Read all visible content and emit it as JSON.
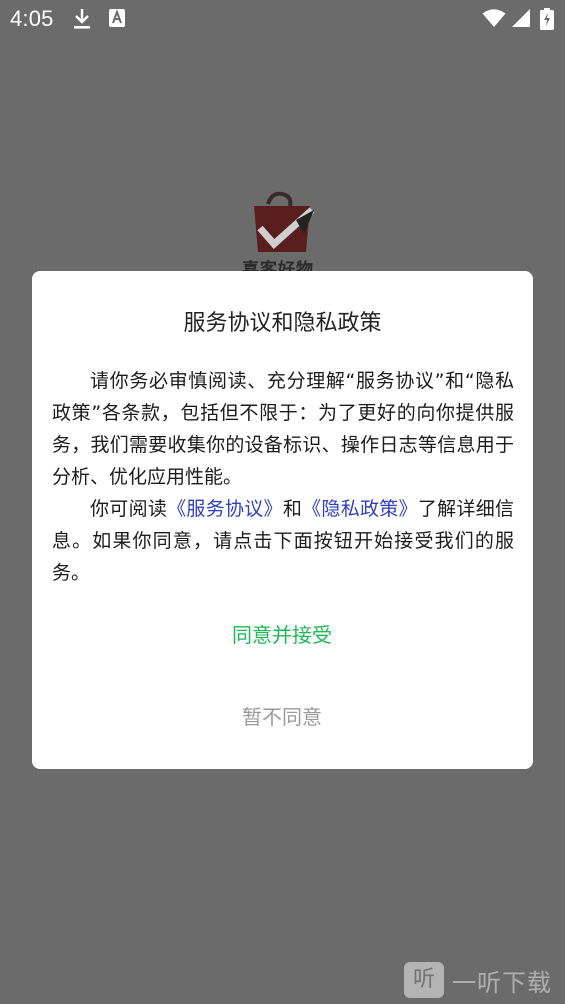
{
  "status_bar": {
    "time": "4:05",
    "icons": [
      "download-icon",
      "a-letter-icon",
      "wifi-icon",
      "signal-icon",
      "battery-charging-icon"
    ]
  },
  "background": {
    "app_name_partial": "喜客好物"
  },
  "dialog": {
    "title": "服务协议和隐私政策",
    "para1": "请你务必审慎阅读、充分理解“服务协议”和“隐私政策”各条款，包括但不限于：为了更好的向你提供服务，我们需要收集你的设备标识、操作日志等信息用于分析、优化应用性能。",
    "para2_prefix": "你可阅读",
    "link_service": "《服务协议》",
    "para2_and": "和",
    "link_privacy": "《隐私政策》",
    "para2_suffix": "了解详细信息。如果你同意，请点击下面按钮开始接受我们的服务。",
    "agree_label": "同意并接受",
    "disagree_label": "暂不同意"
  },
  "watermark": {
    "icon_glyph": "听",
    "text": "一听下载"
  },
  "colors": {
    "overlay": "#6b6b6b",
    "agree": "#1db954",
    "disagree": "#9a9a9a",
    "link": "#2f3fc4"
  }
}
